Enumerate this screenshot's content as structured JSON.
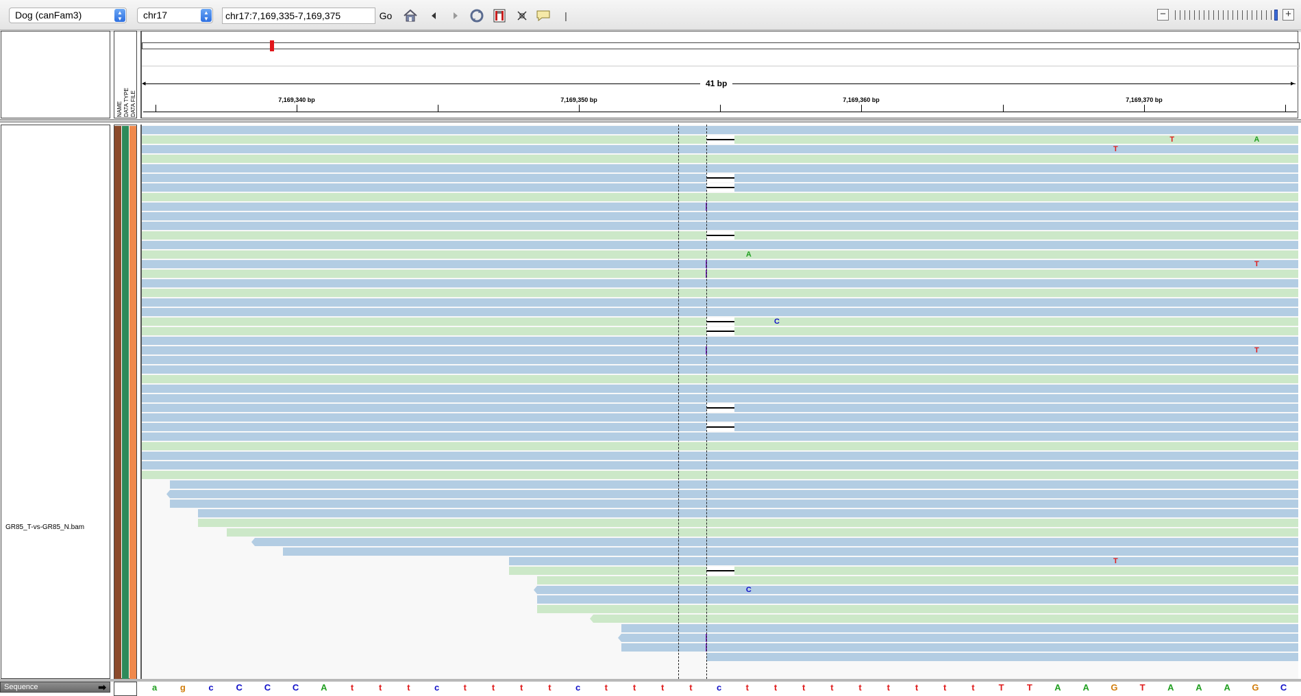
{
  "toolbar": {
    "genome": "Dog (canFam3)",
    "chromosome": "chr17",
    "locus": "chr17:7,169,335-7,169,375",
    "go_label": "Go",
    "zoom_out": "−",
    "zoom_in": "+",
    "divider": "|",
    "icons": [
      "home-icon",
      "back-icon",
      "forward-icon",
      "refresh-icon",
      "region-of-interest-icon",
      "resize-to-window-icon",
      "popup-info-icon"
    ]
  },
  "header": {
    "attribute_labels": [
      "NAME",
      "DATA TYPE",
      "DATA FILE"
    ],
    "span_label": "41 bp",
    "ticks": [
      "7,169,340 bp",
      "7,169,350 bp",
      "7,169,360 bp",
      "7,169,370 bp"
    ]
  },
  "track": {
    "name": "GR85_T-vs-GR85_N.bam",
    "attribute_colors": [
      "#8b4a2b",
      "#2e8a5a",
      "#f0894c"
    ],
    "colors": {
      "forward": "#b3cde3",
      "reverse": "#cce8c8",
      "deletion": "#000000",
      "insertion": "#7b2fbf"
    }
  },
  "reference": {
    "region_start": 7169335,
    "region_end": 7169375,
    "center": 7169355
  },
  "reads": [
    {
      "s": 1,
      "e": 41,
      "st": "f"
    },
    {
      "s": 1,
      "e": 41,
      "st": "r",
      "del": [
        [
          21,
          21
        ]
      ],
      "mm": [
        {
          "p": 37,
          "b": "T"
        },
        {
          "p": 40,
          "b": "A"
        }
      ]
    },
    {
      "s": 1,
      "e": 41,
      "st": "f",
      "mm": [
        {
          "p": 35,
          "b": "T"
        }
      ]
    },
    {
      "s": 1,
      "e": 41,
      "st": "r"
    },
    {
      "s": 1,
      "e": 41,
      "st": "f"
    },
    {
      "s": 1,
      "e": 41,
      "st": "f",
      "del": [
        [
          21,
          21
        ]
      ]
    },
    {
      "s": 1,
      "e": 41,
      "st": "f",
      "del": [
        [
          21,
          21
        ]
      ]
    },
    {
      "s": 1,
      "e": 41,
      "st": "r"
    },
    {
      "s": 1,
      "e": 41,
      "st": "f",
      "ins": [
        21
      ]
    },
    {
      "s": 1,
      "e": 41,
      "st": "f"
    },
    {
      "s": 1,
      "e": 41,
      "st": "f"
    },
    {
      "s": 1,
      "e": 41,
      "st": "r",
      "del": [
        [
          21,
          21
        ]
      ]
    },
    {
      "s": 1,
      "e": 41,
      "st": "f"
    },
    {
      "s": 1,
      "e": 41,
      "st": "r",
      "mm": [
        {
          "p": 22,
          "b": "A"
        }
      ]
    },
    {
      "s": 1,
      "e": 41,
      "st": "f",
      "ins": [
        21
      ],
      "mm": [
        {
          "p": 40,
          "b": "T"
        }
      ]
    },
    {
      "s": 1,
      "e": 41,
      "st": "r",
      "ins": [
        21
      ]
    },
    {
      "s": 1,
      "e": 41,
      "st": "f"
    },
    {
      "s": 1,
      "e": 41,
      "st": "r"
    },
    {
      "s": 1,
      "e": 41,
      "st": "f"
    },
    {
      "s": 1,
      "e": 41,
      "st": "f"
    },
    {
      "s": 1,
      "e": 41,
      "st": "r",
      "del": [
        [
          21,
          21
        ]
      ],
      "mm": [
        {
          "p": 23,
          "b": "C"
        }
      ]
    },
    {
      "s": 1,
      "e": 41,
      "st": "r",
      "del": [
        [
          21,
          21
        ]
      ]
    },
    {
      "s": 1,
      "e": 41,
      "st": "f"
    },
    {
      "s": 1,
      "e": 41,
      "st": "f",
      "ins": [
        21
      ],
      "mm": [
        {
          "p": 40,
          "b": "T"
        }
      ]
    },
    {
      "s": 1,
      "e": 41,
      "st": "f"
    },
    {
      "s": 1,
      "e": 41,
      "st": "f"
    },
    {
      "s": 1,
      "e": 41,
      "st": "r"
    },
    {
      "s": 1,
      "e": 41,
      "st": "f"
    },
    {
      "s": 1,
      "e": 41,
      "st": "f"
    },
    {
      "s": 1,
      "e": 41,
      "st": "f",
      "del": [
        [
          21,
          21
        ]
      ]
    },
    {
      "s": 1,
      "e": 41,
      "st": "f"
    },
    {
      "s": 1,
      "e": 41,
      "st": "f",
      "del": [
        [
          21,
          21
        ]
      ]
    },
    {
      "s": 1,
      "e": 41,
      "st": "f"
    },
    {
      "s": 1,
      "e": 41,
      "st": "r"
    },
    {
      "s": 1,
      "e": 41,
      "st": "f"
    },
    {
      "s": 1,
      "e": 41,
      "st": "f"
    },
    {
      "s": 1,
      "e": 41,
      "st": "r"
    },
    {
      "s": 2,
      "e": 41,
      "st": "f"
    },
    {
      "s": 2,
      "e": 41,
      "st": "f",
      "tip": "l"
    },
    {
      "s": 2,
      "e": 41,
      "st": "f"
    },
    {
      "s": 3,
      "e": 41,
      "st": "f"
    },
    {
      "s": 3,
      "e": 41,
      "st": "r"
    },
    {
      "s": 4,
      "e": 41,
      "st": "r"
    },
    {
      "s": 5,
      "e": 41,
      "st": "f",
      "tip": "l"
    },
    {
      "s": 6,
      "e": 41,
      "st": "f"
    },
    {
      "s": 14,
      "e": 41,
      "st": "f",
      "mm": [
        {
          "p": 35,
          "b": "T"
        }
      ]
    },
    {
      "s": 14,
      "e": 41,
      "st": "r",
      "del": [
        [
          21,
          21
        ]
      ]
    },
    {
      "s": 15,
      "e": 41,
      "st": "r"
    },
    {
      "s": 15,
      "e": 41,
      "st": "f",
      "tip": "l",
      "mm": [
        {
          "p": 22,
          "b": "C"
        }
      ]
    },
    {
      "s": 15,
      "e": 41,
      "st": "f"
    },
    {
      "s": 15,
      "e": 41,
      "st": "r"
    },
    {
      "s": 17,
      "e": 41,
      "st": "r",
      "tip": "l"
    },
    {
      "s": 18,
      "e": 41,
      "st": "f"
    },
    {
      "s": 18,
      "e": 41,
      "st": "f",
      "tip": "l",
      "ins": [
        21
      ]
    },
    {
      "s": 18,
      "e": 41,
      "st": "f",
      "ins": [
        21
      ]
    },
    {
      "s": 21,
      "e": 41,
      "st": "f"
    }
  ],
  "sequence": {
    "label": "Sequence",
    "arrow": "➡",
    "bases": [
      "a",
      "g",
      "c",
      "C",
      "C",
      "C",
      "A",
      "t",
      "t",
      "t",
      "c",
      "t",
      "t",
      "t",
      "t",
      "c",
      "t",
      "t",
      "t",
      "t",
      "c",
      "t",
      "t",
      "t",
      "t",
      "t",
      "t",
      "t",
      "t",
      "t",
      "T",
      "T",
      "A",
      "A",
      "G",
      "T",
      "A",
      "A",
      "A",
      "G",
      "C"
    ],
    "colors": {
      "A": "#22a022",
      "C": "#1010c8",
      "G": "#d17d0c",
      "T": "#e01e1e"
    }
  }
}
